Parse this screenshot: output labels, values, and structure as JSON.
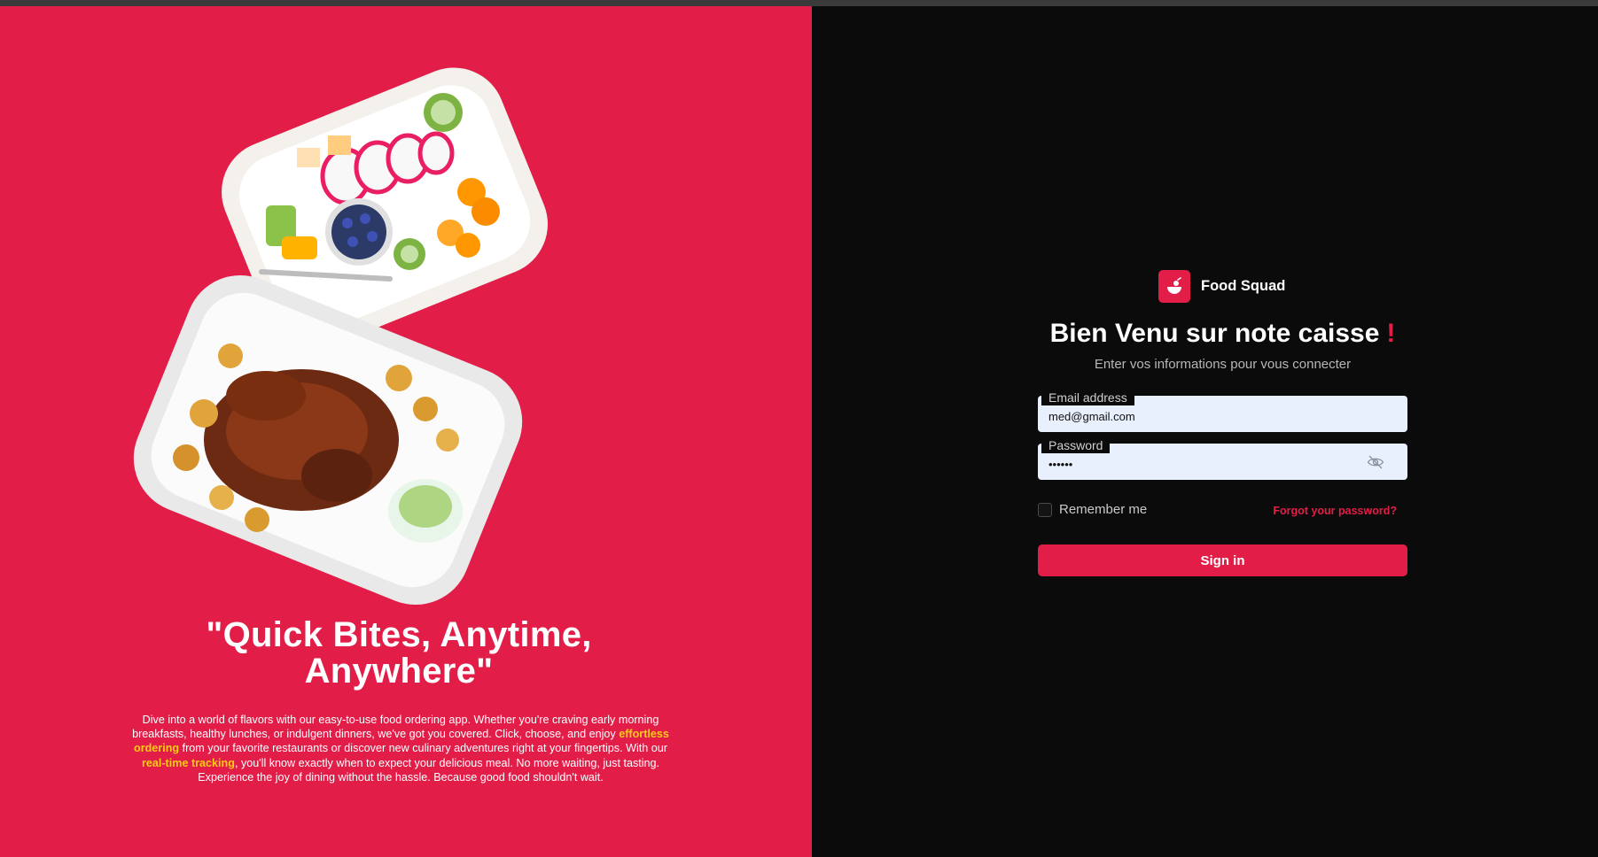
{
  "colors": {
    "brand_red": "#e11d48",
    "dark_bg": "#0b0b0b",
    "highlight_yellow": "#facc15"
  },
  "hero": {
    "title": "\"Quick Bites, Anytime, Anywhere\"",
    "text_part1": "Dive into a world of flavors with our easy-to-use food ordering app. Whether you're craving early morning breakfasts, healthy lunches, or indulgent dinners, we've got you covered. Click, choose, and enjoy ",
    "highlight1": "effortless ordering",
    "text_part2": " from your favorite restaurants or discover new culinary adventures right at your fingertips. With our ",
    "highlight2": "real-time tracking",
    "text_part3": ", you'll know exactly when to expect your delicious meal. No more waiting, just tasting. Experience the joy of dining without the hassle. Because good food shouldn't wait."
  },
  "brand": {
    "name": "Food Squad",
    "icon": "food-bowl-icon"
  },
  "login": {
    "welcome": "Bien Venu sur note caisse",
    "welcome_mark": "!",
    "subtitle": "Enter vos informations pour vous connecter",
    "email_label": "Email address",
    "email_value": "med@gmail.com",
    "password_label": "Password",
    "password_value": "••••••",
    "password_toggle_icon": "eye-off-icon",
    "remember_label": "Remember me",
    "forgot_label": "Forgot your password?",
    "signin_label": "Sign in"
  }
}
